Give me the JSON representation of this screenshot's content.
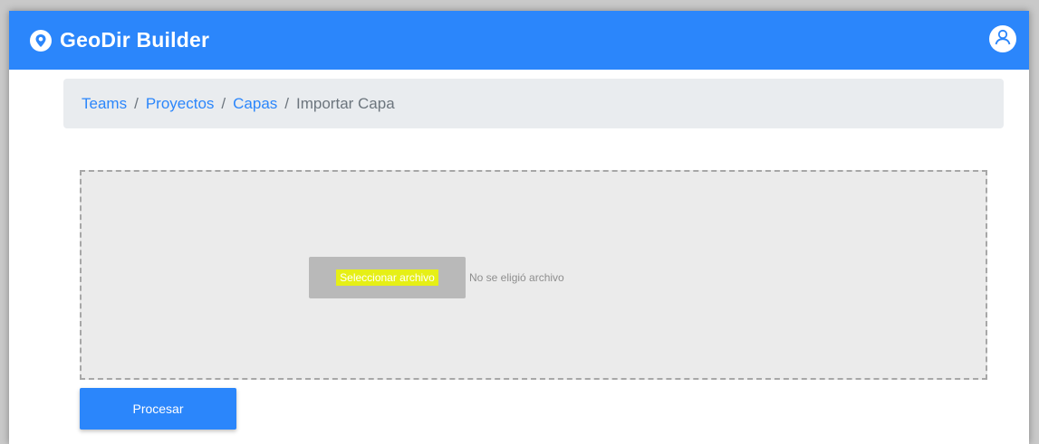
{
  "navbar": {
    "brand_name": "GeoDir Builder",
    "brand_icon": "location-pin-icon",
    "user_icon": "user-avatar-icon",
    "color": "#2b86fb"
  },
  "breadcrumb": {
    "items": [
      {
        "label": "Teams",
        "link": true
      },
      {
        "label": "Proyectos",
        "link": true
      },
      {
        "label": "Capas",
        "link": true
      },
      {
        "label": "Importar Capa",
        "link": false
      }
    ],
    "separator": "/"
  },
  "upload": {
    "select_button_label": "Seleccionar archivo",
    "status_text": "No se eligió archivo",
    "highlight_color": "#e6ef16"
  },
  "actions": {
    "process_label": "Procesar"
  }
}
